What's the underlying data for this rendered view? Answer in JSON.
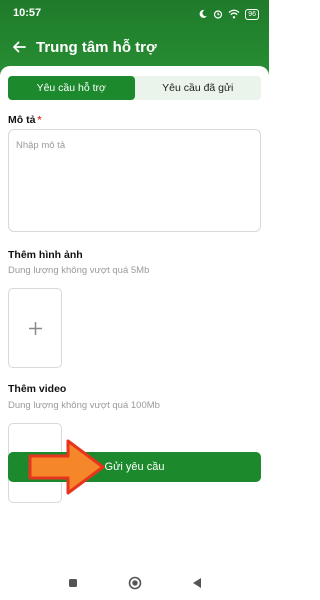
{
  "status_bar": {
    "time": "10:57",
    "battery": "96"
  },
  "header": {
    "title": "Trung tâm hỗ trợ"
  },
  "tabs": [
    {
      "label": "Yêu cầu hỗ trợ",
      "active": true
    },
    {
      "label": "Yêu cầu đã gửi",
      "active": false
    }
  ],
  "form": {
    "description_label": "Mô tả",
    "required_mark": "*",
    "description_placeholder": "Nhập mô tả",
    "image_label": "Thêm hình ảnh",
    "image_hint": "Dung lượng không vượt quá 5Mb",
    "video_label": "Thêm video",
    "video_hint": "Dung lượng không vượt quá 100Mb",
    "submit_label": "Gửi yêu cầu"
  },
  "colors": {
    "brand_green": "#1c8a2c",
    "arrow_red": "#e8341c",
    "arrow_orange": "#f5862a"
  },
  "icons": [
    "back-arrow-icon",
    "plus-icon",
    "moon-icon",
    "alarm-icon",
    "wifi-icon",
    "battery-icon"
  ]
}
